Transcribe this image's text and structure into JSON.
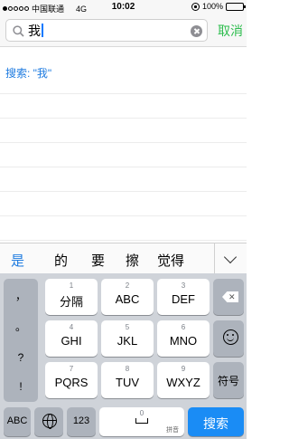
{
  "status_bar": {
    "carrier": "中国联通",
    "network": "4G",
    "time": "10:02",
    "battery": "100%"
  },
  "search": {
    "query": "我",
    "cancel_label": "取消"
  },
  "results": {
    "first": "搜索: \"我\""
  },
  "candidates": [
    "是",
    "的",
    "要",
    "擦",
    "觉得"
  ],
  "keyboard": {
    "punctuation": [
      "，",
      "。",
      "?",
      "!"
    ],
    "keys": [
      {
        "num": "1",
        "label": "分隔"
      },
      {
        "num": "2",
        "label": "ABC"
      },
      {
        "num": "3",
        "label": "DEF"
      },
      {
        "num": "4",
        "label": "GHI"
      },
      {
        "num": "5",
        "label": "JKL"
      },
      {
        "num": "6",
        "label": "MNO"
      },
      {
        "num": "7",
        "label": "PQRS"
      },
      {
        "num": "8",
        "label": "TUV"
      },
      {
        "num": "9",
        "label": "WXYZ"
      }
    ],
    "symbols_label": "符号",
    "abc_label": "ABC",
    "num_label": "123",
    "zero_label": "0",
    "pinyin_label": "拼音",
    "search_label": "搜索"
  },
  "colors": {
    "accent_green": "#2ebd4e",
    "link_blue": "#1e7be0",
    "search_key_blue": "#1a8cf5"
  }
}
